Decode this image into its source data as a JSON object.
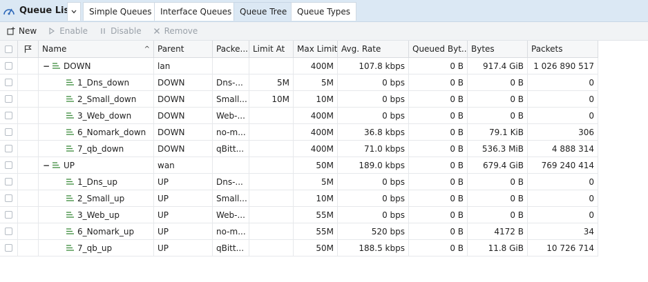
{
  "tabbar": {
    "title": "Queue List",
    "tabs": [
      {
        "label": "Simple Queues",
        "active": false
      },
      {
        "label": "Interface Queues",
        "active": false
      },
      {
        "label": "Queue Tree",
        "active": true
      },
      {
        "label": "Queue Types",
        "active": false
      }
    ]
  },
  "toolbar": {
    "new_label": "New",
    "enable_label": "Enable",
    "disable_label": "Disable",
    "remove_label": "Remove"
  },
  "columns": {
    "name": "Name",
    "parent": "Parent",
    "packet": "Packe...",
    "limit_at": "Limit At",
    "max_limit": "Max Limit",
    "avg_rate": "Avg. Rate",
    "queued": "Queued Byt...",
    "bytes": "Bytes",
    "packets": "Packets"
  },
  "rows": [
    {
      "level": 0,
      "name": "DOWN",
      "parent": "lan",
      "packet": "",
      "limit_at": "",
      "max_limit": "400M",
      "avg_rate": "107.8 kbps",
      "queued": "0 B",
      "bytes": "917.4 GiB",
      "packets": "1 026 890 517"
    },
    {
      "level": 1,
      "name": "1_Dns_down",
      "parent": "DOWN",
      "packet": "Dns-...",
      "limit_at": "5M",
      "max_limit": "5M",
      "avg_rate": "0 bps",
      "queued": "0 B",
      "bytes": "0 B",
      "packets": "0"
    },
    {
      "level": 1,
      "name": "2_Small_down",
      "parent": "DOWN",
      "packet": "Small...",
      "limit_at": "10M",
      "max_limit": "10M",
      "avg_rate": "0 bps",
      "queued": "0 B",
      "bytes": "0 B",
      "packets": "0"
    },
    {
      "level": 1,
      "name": "3_Web_down",
      "parent": "DOWN",
      "packet": "Web-...",
      "limit_at": "",
      "max_limit": "400M",
      "avg_rate": "0 bps",
      "queued": "0 B",
      "bytes": "0 B",
      "packets": "0"
    },
    {
      "level": 1,
      "name": "6_Nomark_down",
      "parent": "DOWN",
      "packet": "no-m...",
      "limit_at": "",
      "max_limit": "400M",
      "avg_rate": "36.8 kbps",
      "queued": "0 B",
      "bytes": "79.1 KiB",
      "packets": "306"
    },
    {
      "level": 1,
      "name": "7_qb_down",
      "parent": "DOWN",
      "packet": "qBitt...",
      "limit_at": "",
      "max_limit": "400M",
      "avg_rate": "71.0 kbps",
      "queued": "0 B",
      "bytes": "536.3 MiB",
      "packets": "4 888 314"
    },
    {
      "level": 0,
      "name": "UP",
      "parent": "wan",
      "packet": "",
      "limit_at": "",
      "max_limit": "50M",
      "avg_rate": "189.0 kbps",
      "queued": "0 B",
      "bytes": "679.4 GiB",
      "packets": "769 240 414"
    },
    {
      "level": 1,
      "name": "1_Dns_up",
      "parent": "UP",
      "packet": "Dns-...",
      "limit_at": "",
      "max_limit": "5M",
      "avg_rate": "0 bps",
      "queued": "0 B",
      "bytes": "0 B",
      "packets": "0"
    },
    {
      "level": 1,
      "name": "2_Small_up",
      "parent": "UP",
      "packet": "Small...",
      "limit_at": "",
      "max_limit": "10M",
      "avg_rate": "0 bps",
      "queued": "0 B",
      "bytes": "0 B",
      "packets": "0"
    },
    {
      "level": 1,
      "name": "3_Web_up",
      "parent": "UP",
      "packet": "Web-...",
      "limit_at": "",
      "max_limit": "55M",
      "avg_rate": "0 bps",
      "queued": "0 B",
      "bytes": "0 B",
      "packets": "0"
    },
    {
      "level": 1,
      "name": "6_Nomark_up",
      "parent": "UP",
      "packet": "no-m...",
      "limit_at": "",
      "max_limit": "55M",
      "avg_rate": "520 bps",
      "queued": "0 B",
      "bytes": "4172 B",
      "packets": "34"
    },
    {
      "level": 1,
      "name": "7_qb_up",
      "parent": "UP",
      "packet": "qBitt...",
      "limit_at": "",
      "max_limit": "50M",
      "avg_rate": "188.5 kbps",
      "queued": "0 B",
      "bytes": "11.8 GiB",
      "packets": "10 726 714"
    }
  ],
  "colors": {
    "accent": "#2c67b9",
    "queue_icon": "#3a8a3a",
    "tabbar_bg": "#dbe8f4"
  }
}
